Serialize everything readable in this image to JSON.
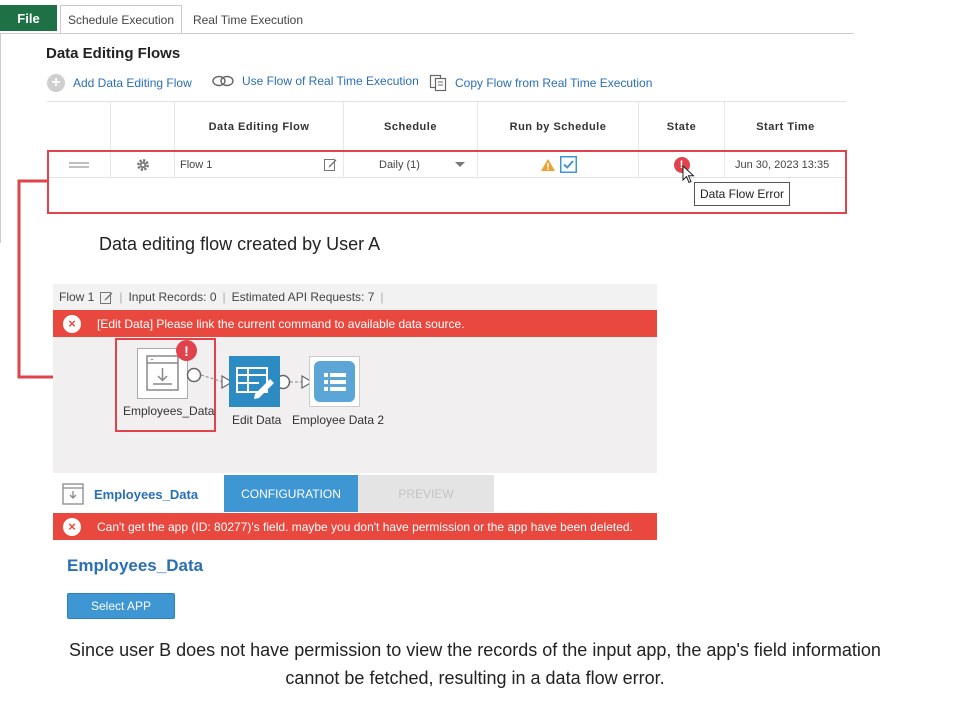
{
  "tabs": {
    "file": "File",
    "schedule": "Schedule Execution",
    "realtime": "Real Time Execution"
  },
  "section_title": "Data Editing Flows",
  "actions": {
    "add": "Add Data Editing Flow",
    "use": "Use Flow of Real Time Execution",
    "copy": "Copy Flow from Real Time Execution"
  },
  "table": {
    "headers": [
      "Data Editing Flow",
      "Schedule",
      "Run by Schedule",
      "State",
      "Start Time"
    ],
    "row": {
      "flow": "Flow 1",
      "schedule": "Daily (1)",
      "start": "Jun 30, 2023 13:35"
    }
  },
  "tooltip": "Data Flow Error",
  "caption_user_a": "Data editing flow created by User A",
  "flow_info": {
    "name": "Flow 1",
    "input": "Input Records: 0",
    "api": "Estimated API Requests: 7"
  },
  "flow_error": "[Edit Data] Please link the current command to available data source.",
  "nodes": {
    "n1": "Employees_Data",
    "n2": "Edit Data",
    "n3": "Employee Data 2"
  },
  "bottom": {
    "node_name": "Employees_Data",
    "config_tab": "CONFIGURATION",
    "preview_tab": "PREVIEW"
  },
  "app_error": "Can't get the app (ID: 80277)'s field. maybe you don't have permission or the app have been deleted.",
  "panel_title": "Employees_Data",
  "select_app": "Select APP",
  "caption_user_b": "Since user B does not have permission to view the records of the input app, the app's field information cannot be fetched, resulting in a data flow error.",
  "colors": {
    "accent": "#3e97d3",
    "error": "#e9483f",
    "highlight": "#e0434b",
    "file_tab": "#1e7145",
    "link": "#2a6fb6"
  }
}
